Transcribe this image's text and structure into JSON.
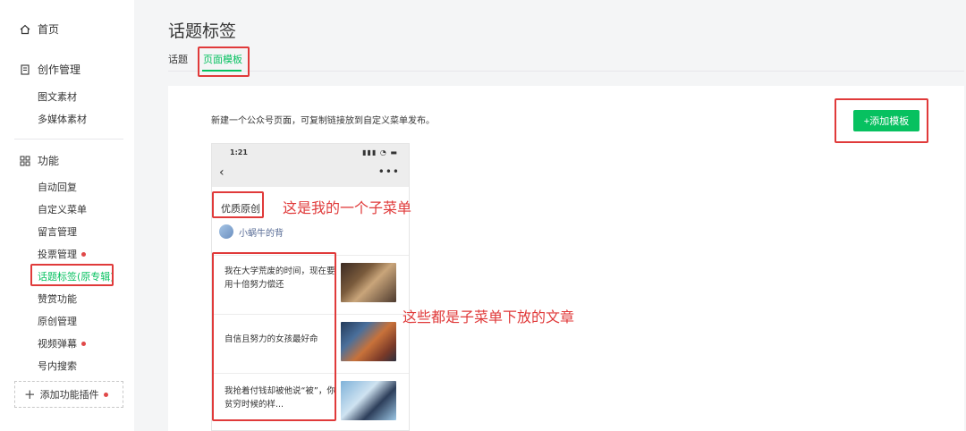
{
  "sidebar": {
    "home": "首页",
    "creation": "创作管理",
    "creation_items": [
      "图文素材",
      "多媒体素材"
    ],
    "features": "功能",
    "feature_items": [
      {
        "label": "自动回复",
        "dot": false
      },
      {
        "label": "自定义菜单",
        "dot": false
      },
      {
        "label": "留言管理",
        "dot": false
      },
      {
        "label": "投票管理",
        "dot": true
      },
      {
        "label": "话题标签(原专辑)",
        "dot": false
      },
      {
        "label": "赞赏功能",
        "dot": false
      },
      {
        "label": "原创管理",
        "dot": false
      },
      {
        "label": "视频弹幕",
        "dot": true
      },
      {
        "label": "号内搜索",
        "dot": false
      }
    ],
    "add_plugin": "添加功能插件"
  },
  "header": {
    "title": "话题标签",
    "tabs": [
      "话题",
      "页面模板"
    ],
    "active_tab": "页面模板"
  },
  "panel": {
    "description": "新建一个公众号页面，可复制链接放到自定义菜单发布。",
    "add_button": "+添加模板"
  },
  "phone": {
    "time": "1:21",
    "status_icons": "▮▮▮ ◔ ▬",
    "submenu_title": "优质原创",
    "author": "小蜗牛的背",
    "articles": [
      "我在大学荒废的时间，现在要用十倍努力偿还",
      "自信且努力的女孩最好命",
      "我抢着付钱却被他说“被”，你贫穷时候的样..."
    ]
  },
  "annotations": {
    "submenu_note": "这是我的一个子菜单",
    "articles_note": "这些都是子菜单下放的文章"
  },
  "colors": {
    "accent": "#07c160",
    "highlight_box": "#e03a3a",
    "link": "#576b95"
  }
}
